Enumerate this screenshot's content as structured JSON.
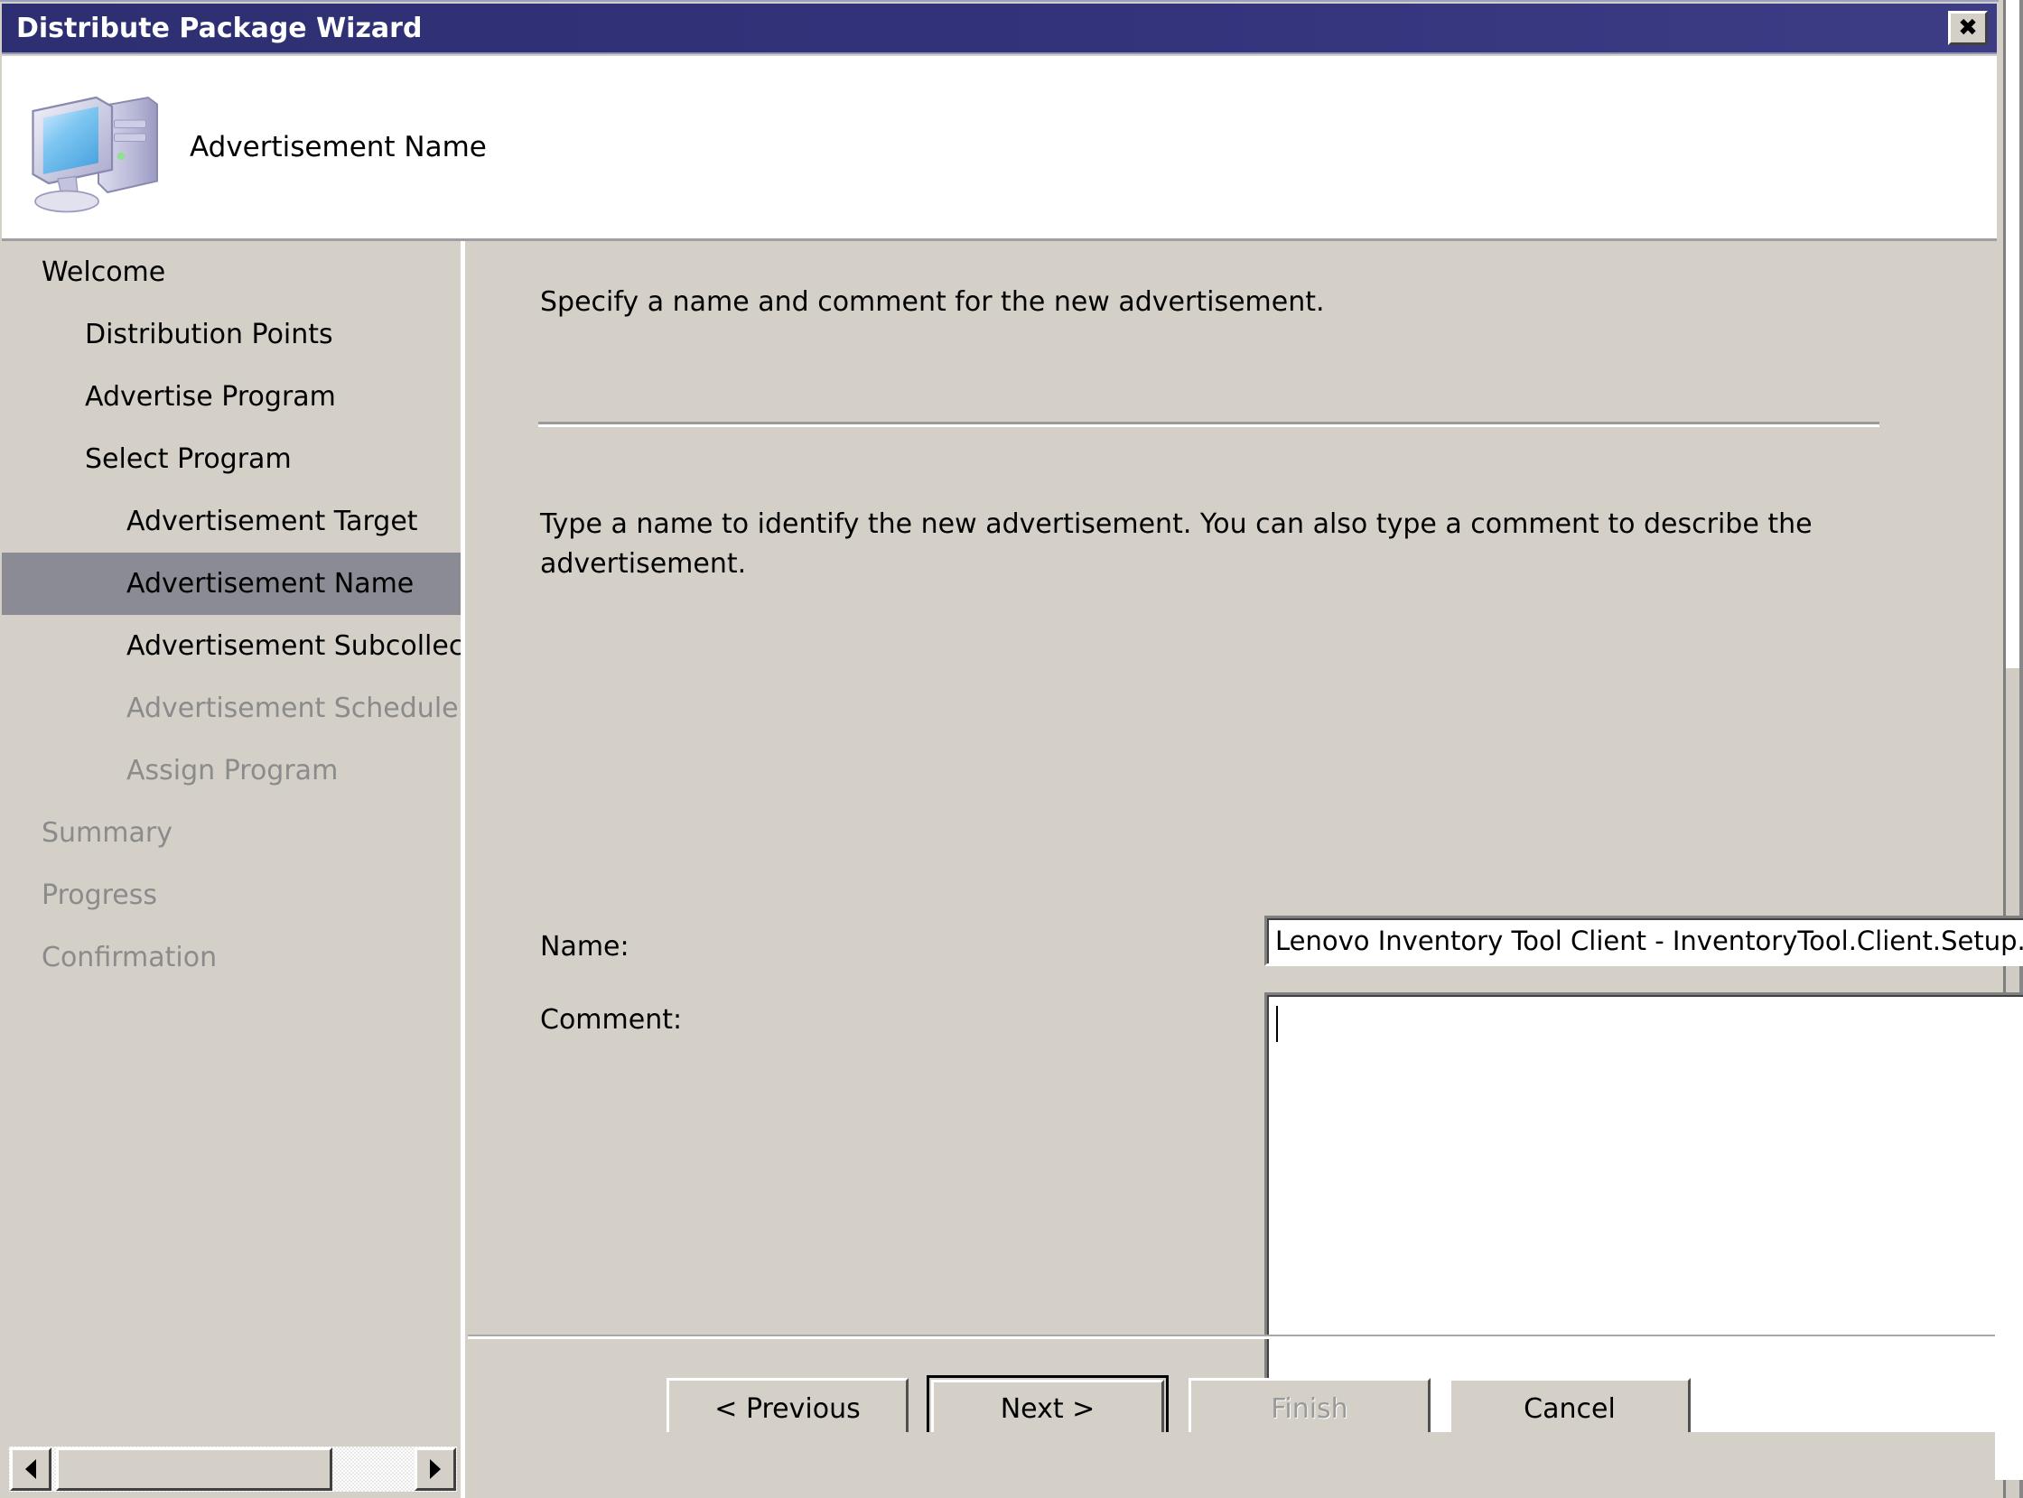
{
  "window": {
    "title": "Distribute Package Wizard",
    "close_label": "✕"
  },
  "header": {
    "icon": "computer-icon",
    "title": "Advertisement Name"
  },
  "sidebar": {
    "items": [
      {
        "label": "Welcome",
        "level": 0,
        "state": "normal"
      },
      {
        "label": "Distribution Points",
        "level": 1,
        "state": "normal"
      },
      {
        "label": "Advertise Program",
        "level": 1,
        "state": "normal"
      },
      {
        "label": "Select Program",
        "level": 1,
        "state": "normal"
      },
      {
        "label": "Advertisement Target",
        "level": 2,
        "state": "normal"
      },
      {
        "label": "Advertisement Name",
        "level": 2,
        "state": "selected"
      },
      {
        "label": "Advertisement Subcollec",
        "level": 2,
        "state": "normal"
      },
      {
        "label": "Advertisement Schedule",
        "level": 2,
        "state": "disabled"
      },
      {
        "label": "Assign Program",
        "level": 2,
        "state": "disabled"
      },
      {
        "label": "Summary",
        "level": 0,
        "state": "disabled"
      },
      {
        "label": "Progress",
        "level": 0,
        "state": "disabled"
      },
      {
        "label": "Confirmation",
        "level": 0,
        "state": "disabled"
      }
    ]
  },
  "content": {
    "intro": "Specify a name and comment for the new advertisement.",
    "body": "Type a name to identify the new advertisement. You can also type a comment to describe the advertisement.",
    "name_label": "Name:",
    "name_value": "Lenovo Inventory Tool Client - InventoryTool.Client.Setup.msi to All Systems",
    "name_placeholder": "",
    "comment_label": "Comment:",
    "comment_value": "",
    "comment_placeholder": ""
  },
  "footer": {
    "previous_label": "< Previous",
    "next_label": "Next >",
    "finish_label": "Finish",
    "cancel_label": "Cancel"
  },
  "colors": {
    "titlebar": "#2e2e72",
    "dialog_face": "#d4d0c8",
    "selection": "#8b8b95",
    "disabled_text": "#8b8b8b"
  }
}
